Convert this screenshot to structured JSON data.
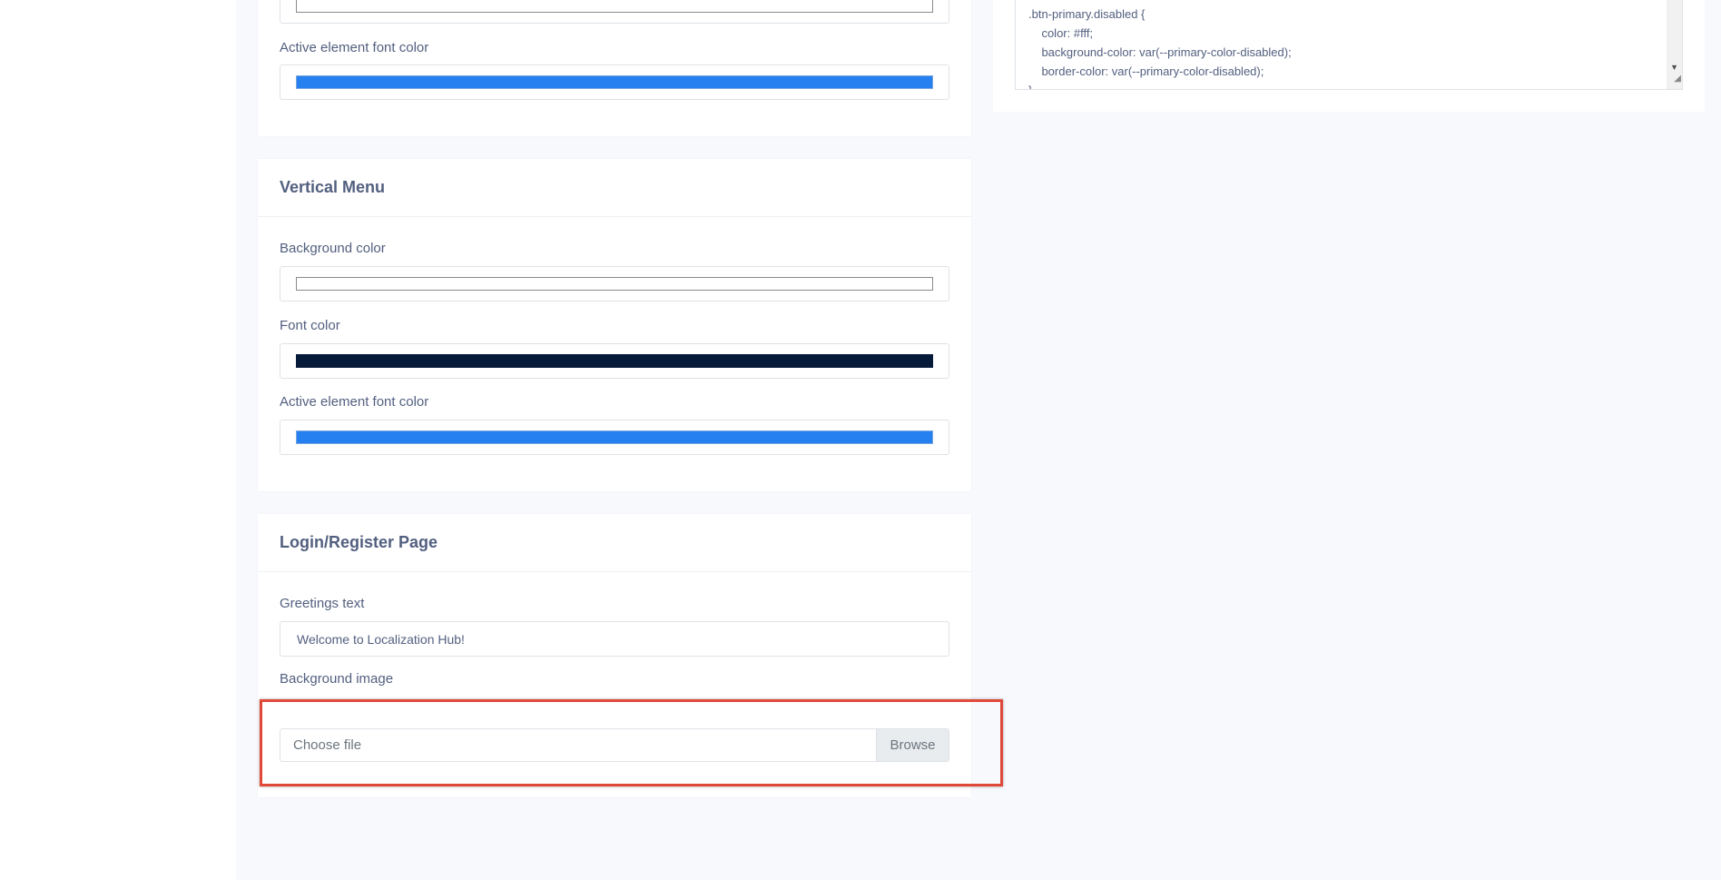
{
  "top_section": {
    "active_font_label": "Active element font color",
    "active_font_color": "#2680f0",
    "background_color": "#ffffff"
  },
  "vertical_menu": {
    "title": "Vertical Menu",
    "bg_label": "Background color",
    "bg_color": "#ffffff",
    "font_label": "Font color",
    "font_color": "#061a3a",
    "active_font_label": "Active element font color",
    "active_font_color": "#2680f0"
  },
  "login_page": {
    "title": "Login/Register Page",
    "greetings_label": "Greetings text",
    "greetings_value": "Welcome to Localization Hub!",
    "bg_image_label": "Background image",
    "file_placeholder": "Choose file",
    "browse_label": "Browse"
  },
  "css_editor": {
    "lines": [
      ".btn-primary.disabled {",
      "    color: #fff;",
      "    background-color: var(--primary-color-disabled);",
      "    border-color: var(--primary-color-disabled);",
      "}"
    ],
    "scroll_down_icon": "triangle-down",
    "resize_icon": "resize-grip"
  },
  "colors": {
    "highlight": "#e0493a",
    "page_bg": "#f7f9fd"
  }
}
